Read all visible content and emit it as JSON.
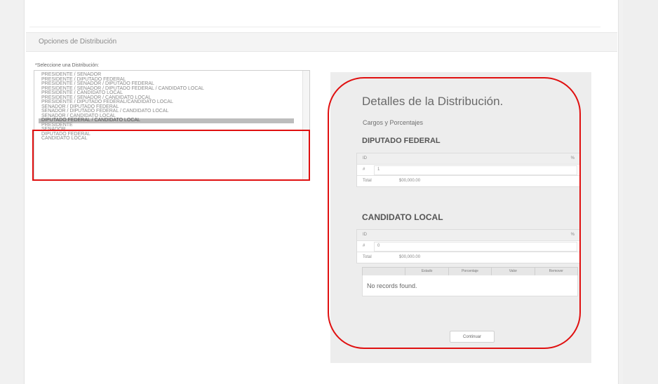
{
  "section": {
    "title": "Opciones de Distribución"
  },
  "select": {
    "label": "*Seleccione una Distribución:",
    "options": [
      "PRESIDENTE / SENADOR",
      "PRESIDENTE / DIPUTADO FEDERAL",
      "PRESIDENTE / SENADOR / DIPUTADO FEDERAL",
      "PRESIDENTE / SENADOR / DIPUTADO FEDERAL / CANDIDATO LOCAL",
      "PRESIDENTE / CANDIDATO LOCAL",
      "PRESIDENTE / SENADOR / CANDIDATO LOCAL",
      "PRESIDENTE / DIPUTADO FEDERAL/CANDIDATO LOCAL",
      "SENADOR / DIPUTADO FEDERAL",
      "SENADOR / DIPUTADO FEDERAL / CANDIDATO LOCAL",
      "SENADOR / CANDIDATO LOCAL",
      "DIPUTADO FEDERAL / CANDIDATO LOCAL",
      "PRESIDENTE",
      "SENADOR",
      "DIPUTADO FEDERAL",
      "CANDIDATO LOCAL"
    ],
    "selected": "DIPUTADO FEDERAL / CANDIDATO LOCAL"
  },
  "details": {
    "title": "Detalles de la Distribución.",
    "subtitle": "Cargos y Porcentajes",
    "candidates": [
      {
        "name": "DIPUTADO FEDERAL",
        "header_left": "ID",
        "header_right": "%",
        "row_label": "#",
        "value": "1",
        "total_label": "Total",
        "total_value": "$00,000.00"
      },
      {
        "name": "CANDIDATO LOCAL",
        "header_left": "ID",
        "header_right": "%",
        "row_label": "#",
        "value": "0",
        "total_label": "Total",
        "total_value": "$00,000.00"
      }
    ],
    "grid_columns": [
      "",
      "Estado",
      "Porcentaje",
      "Valor",
      "Remover"
    ],
    "empty_message": "No records found.",
    "continue_label": "Continuar"
  },
  "colors": {
    "highlight": "#e01010",
    "selected_row": "#bdbdbd"
  }
}
